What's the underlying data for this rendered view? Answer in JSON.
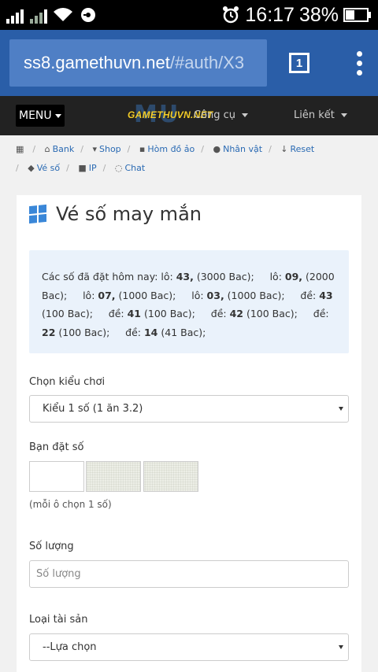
{
  "status": {
    "time": "16:17",
    "battery": "38%"
  },
  "browser": {
    "url_host": "ss8.gamethuvn.net",
    "url_path": "/#auth/X3",
    "tab_count": "1"
  },
  "navbar": {
    "menu_label": "MENU",
    "logo_text": "GAMETHUVN.NET",
    "logo_mark": "MU",
    "item1": "Công cụ",
    "item2": "Liên kết"
  },
  "breadcrumb": {
    "bank": "Bank",
    "shop": "Shop",
    "hom_do_ao": "Hòm đồ ảo",
    "nhan_vat": "Nhân vật",
    "reset": "Reset",
    "ve_so": "Vé số",
    "ip": "IP",
    "chat": "Chat"
  },
  "card": {
    "title": "Vé số may mắn"
  },
  "info": {
    "intro": "Các số đã đặt hôm nay:",
    "bets": [
      {
        "type": "lô",
        "num": "43,",
        "amount": "(3000 Bac);"
      },
      {
        "type": "lô",
        "num": "09,",
        "amount": "(2000 Bac);"
      },
      {
        "type": "lô",
        "num": "07,",
        "amount": "(1000 Bac);"
      },
      {
        "type": "lô",
        "num": "03,",
        "amount": "(1000 Bac);"
      },
      {
        "type": "đề",
        "num": "43",
        "amount": "(100 Bac);"
      },
      {
        "type": "đề",
        "num": "41",
        "amount": "(100 Bac);"
      },
      {
        "type": "đề",
        "num": "42",
        "amount": "(100 Bac);"
      },
      {
        "type": "đề",
        "num": "22",
        "amount": "(100 Bac);"
      },
      {
        "type": "đề",
        "num": "14",
        "amount": "(41 Bac);"
      }
    ]
  },
  "form": {
    "play_type_label": "Chọn kiểu chơi",
    "play_type_value": "Kiểu 1 số (1 ăn 3.2)",
    "bet_number_label": "Bạn đặt số",
    "bet_number_hint": "(mỗi ô chọn 1 số)",
    "quantity_label": "Số lượng",
    "quantity_placeholder": "Số lượng",
    "asset_label": "Loại tài sản",
    "asset_value": "--Lựa chọn"
  }
}
